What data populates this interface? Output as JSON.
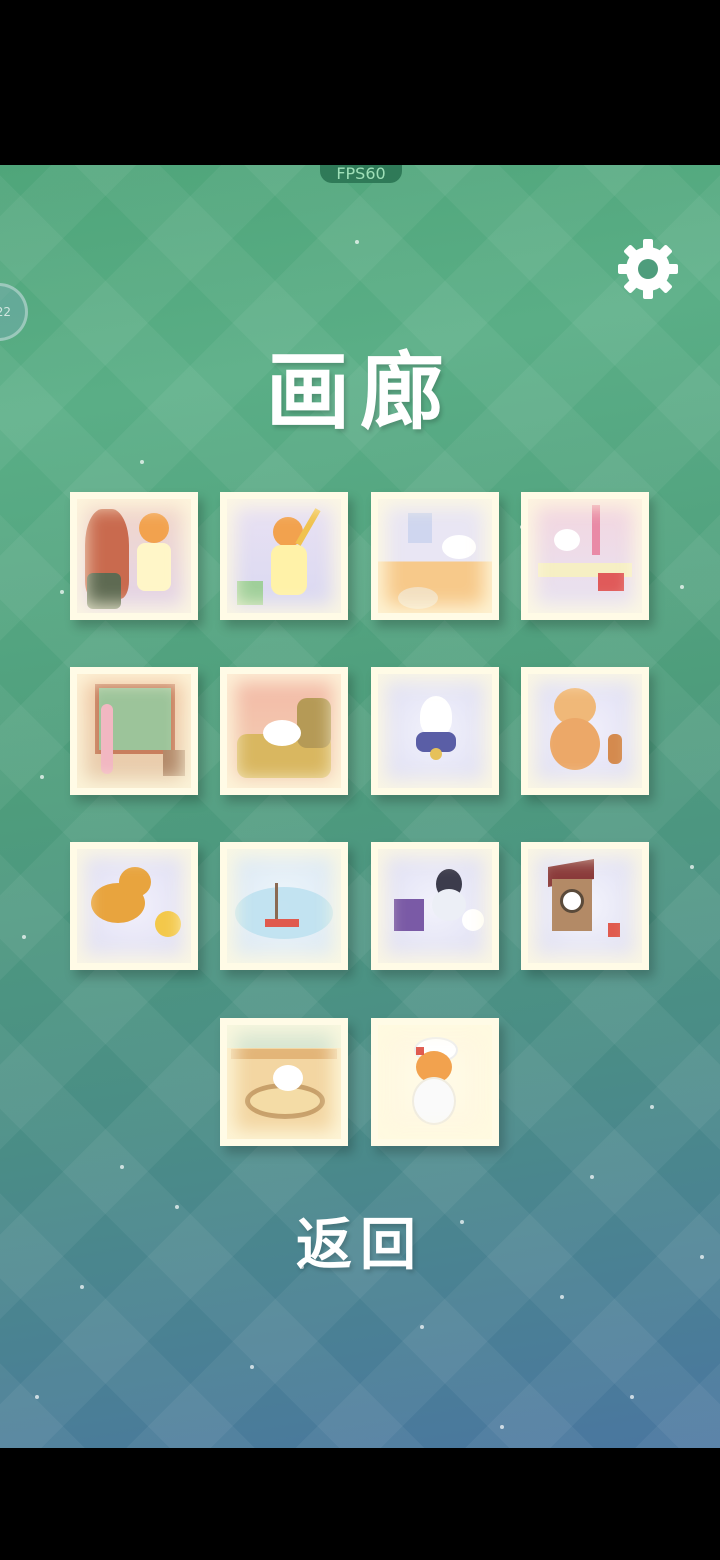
{
  "status": {
    "fps_label": "FPS60",
    "side_badge": "22"
  },
  "header": {
    "title": "画廊"
  },
  "icons": {
    "settings": "gear-icon"
  },
  "gallery": {
    "items": [
      {
        "name": "girl-with-mirror"
      },
      {
        "name": "girl-with-duster-and-cat"
      },
      {
        "name": "cat-on-brick-wall"
      },
      {
        "name": "cat-on-shelf-with-toys"
      },
      {
        "name": "cat-at-window"
      },
      {
        "name": "cat-on-armchair"
      },
      {
        "name": "ghost-cat-with-bow"
      },
      {
        "name": "teddy-bear-with-cookie"
      },
      {
        "name": "shiba-dog-with-toy"
      },
      {
        "name": "ship-in-bottle"
      },
      {
        "name": "penguin-and-snowman"
      },
      {
        "name": "cuckoo-clock"
      },
      {
        "name": "cat-on-cushion"
      },
      {
        "name": "girl-with-white-cat"
      }
    ]
  },
  "footer": {
    "back_label": "返回"
  }
}
